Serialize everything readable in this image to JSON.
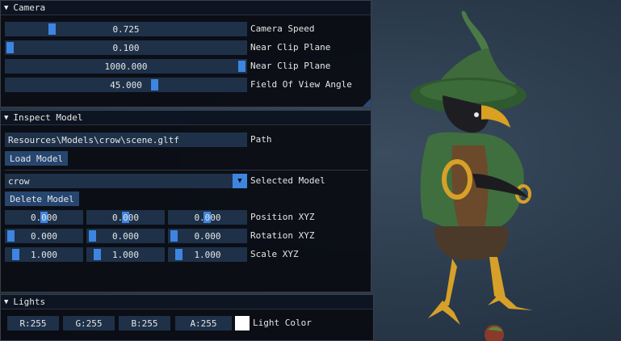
{
  "camera": {
    "title": "Camera",
    "sliders": [
      {
        "value": "0.725",
        "label": "Camera Speed",
        "fraction": 0.18
      },
      {
        "value": "0.100",
        "label": "Near Clip Plane",
        "fraction": 0.0
      },
      {
        "value": "1000.000",
        "label": "Near Clip Plane",
        "fraction": 1.0
      },
      {
        "value": "45.000",
        "label": "Field Of View Angle",
        "fraction": 0.6
      }
    ]
  },
  "inspect": {
    "title": "Inspect Model",
    "path_value": "Resources\\Models\\crow\\scene.gltf",
    "path_label": "Path",
    "load_button": "Load Model",
    "selected_model": "crow",
    "selected_label": "Selected Model",
    "delete_button": "Delete Model",
    "position": {
      "label": "Position XYZ",
      "values": [
        "0.000",
        "0.000",
        "0.000"
      ]
    },
    "rotation": {
      "label": "Rotation XYZ",
      "values": [
        "0.000",
        "0.000",
        "0.000"
      ]
    },
    "scale": {
      "label": "Scale XYZ",
      "values": [
        "1.000",
        "1.000",
        "1.000"
      ]
    }
  },
  "lights": {
    "title": "Lights",
    "channels": [
      "R:255",
      "G:255",
      "B:255",
      "A:255"
    ],
    "color_label": "Light Color",
    "swatch_color": "#ffffff"
  },
  "icons": {
    "collapse": "caret-down-icon",
    "combo": "dropdown-arrow-icon"
  }
}
